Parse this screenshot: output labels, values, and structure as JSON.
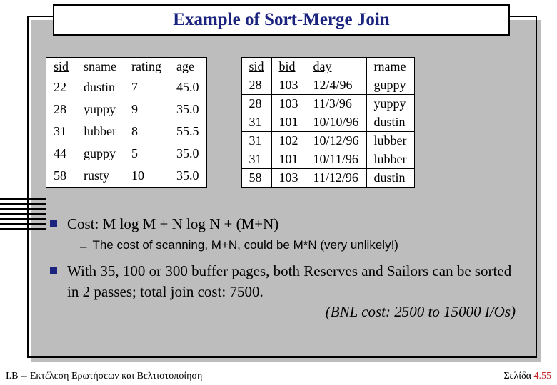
{
  "title": "Example of Sort-Merge Join",
  "table_left": {
    "headers": [
      "sid",
      "sname",
      "rating",
      "age"
    ],
    "underline": [
      true,
      false,
      false,
      false
    ],
    "rows": [
      [
        "22",
        "dustin",
        "7",
        "45.0"
      ],
      [
        "28",
        "yuppy",
        "9",
        "35.0"
      ],
      [
        "31",
        "lubber",
        "8",
        "55.5"
      ],
      [
        "44",
        "guppy",
        "5",
        "35.0"
      ],
      [
        "58",
        "rusty",
        "10",
        "35.0"
      ]
    ]
  },
  "table_right": {
    "headers": [
      "sid",
      "bid",
      "day",
      "rname"
    ],
    "underline": [
      true,
      true,
      true,
      false
    ],
    "rows": [
      [
        "28",
        "103",
        "12/4/96",
        "guppy"
      ],
      [
        "28",
        "103",
        "11/3/96",
        "yuppy"
      ],
      [
        "31",
        "101",
        "10/10/96",
        "dustin"
      ],
      [
        "31",
        "102",
        "10/12/96",
        "lubber"
      ],
      [
        "31",
        "101",
        "10/11/96",
        "lubber"
      ],
      [
        "58",
        "103",
        "11/12/96",
        "dustin"
      ]
    ]
  },
  "bullets": {
    "b1": "Cost:  M log M + N log N + (M+N)",
    "sub1": "The cost of scanning, M+N, could be M*N (very unlikely!)",
    "b2": "With 35, 100 or 300 buffer pages, both Reserves and Sailors can be sorted in 2 passes; total join cost: 7500.",
    "b2_italic": "(BNL cost:  2500 to 15000 I/Os)"
  },
  "footer": {
    "left": "Ι.Β -- Εκτέλεση Ερωτήσεων και Βελτιστοποίηση",
    "right_label": "Σελίδα ",
    "right_num": "4.55"
  }
}
